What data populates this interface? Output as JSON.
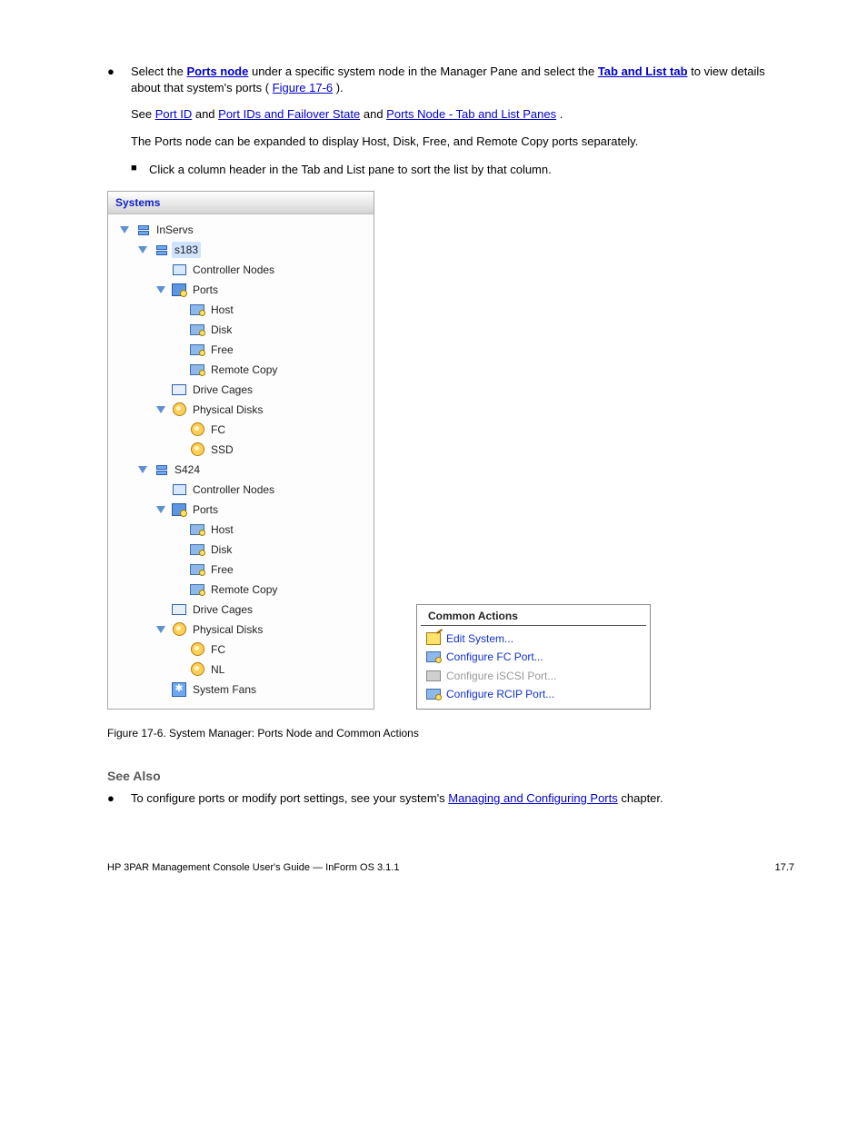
{
  "body": {
    "bullet1_prefix": "●",
    "bullet1_text_before": "Select the ",
    "bullet1_link1": "Ports node",
    "bullet1_text_middle": " under a specific system node in the Manager Pane and select the ",
    "bullet1_link2": "Tab and List tab",
    "bullet1_text_after": " to view details about that system's ports (",
    "bullet1_link3": "Figure 17-6",
    "bullet1_text_end": ").",
    "bullet1_see_before": "See ",
    "bullet1_see_link1": "Port ID",
    "bullet1_see_mid": " and ",
    "bullet1_see_link2": "Port IDs and Failover State",
    "bullet1_see_after": " and ",
    "bullet1_see_link3": "Ports Node - Tab and List Panes",
    "bullet1_see_end": ".",
    "para_last": "The Ports node can be expanded to display Host, Disk, Free, and Remote Copy ports separately.",
    "bullet2_prefix": "■",
    "bullet2_text": "Click a column header in the Tab and List pane to sort the list by that column.",
    "fig_caption": "Figure 17-6.  System Manager: Ports Node and Common Actions",
    "see_also_title": "See Also",
    "see_also_bullet": "●",
    "see_also_before": "To configure ports or modify port settings, see your system's ",
    "see_also_link": "Managing and Configuring Ports",
    "see_also_after": " chapter."
  },
  "tree": {
    "header": "Systems",
    "root": "InServs",
    "sys1": "s183",
    "sys2": "S424",
    "ctrl": "Controller Nodes",
    "ports": "Ports",
    "p_host": "Host",
    "p_disk": "Disk",
    "p_free": "Free",
    "p_rc": "Remote Copy",
    "cages": "Drive Cages",
    "pdisks": "Physical Disks",
    "fc": "FC",
    "ssd": "SSD",
    "nl": "NL",
    "fans": "System Fans"
  },
  "ca": {
    "title": "Common Actions",
    "edit": "Edit System...",
    "cfg_fc": "Configure FC Port...",
    "cfg_iscsi": "Configure iSCSI Port...",
    "cfg_rcip": "Configure RCIP Port..."
  },
  "footer": {
    "left": "HP 3PAR Management Console User's Guide — InForm OS 3.1.1",
    "right": "17.7"
  }
}
